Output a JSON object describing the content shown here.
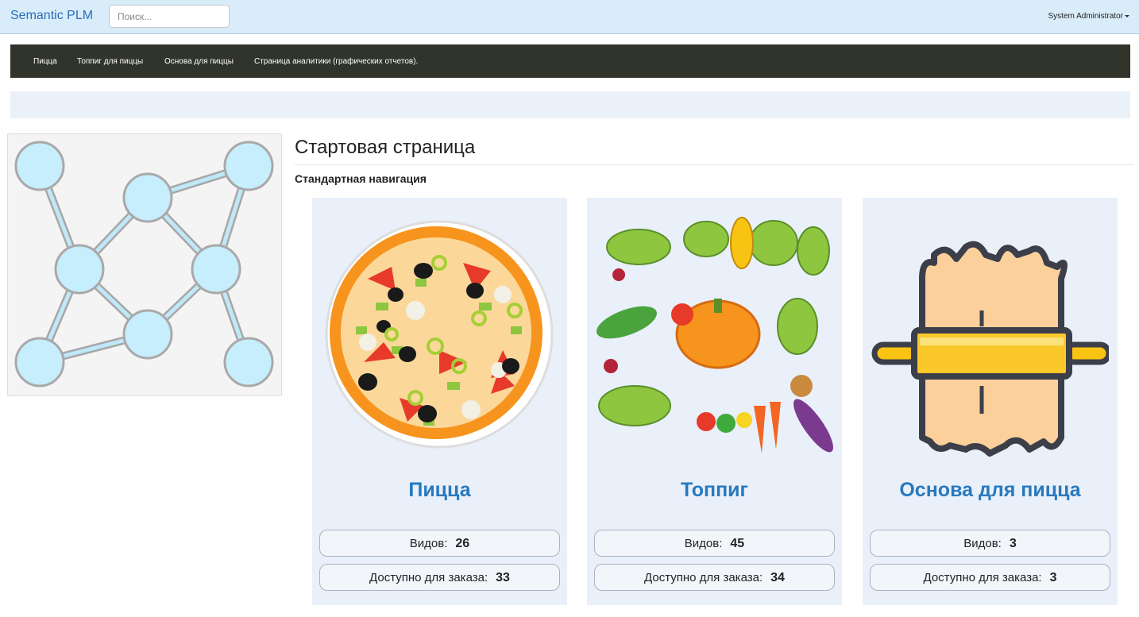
{
  "app": {
    "brand": "Semantic PLM"
  },
  "search": {
    "placeholder": "Поиск..."
  },
  "user": {
    "name": "System Administrator"
  },
  "menu": {
    "items": [
      {
        "label": "Пицца"
      },
      {
        "label": "Топпиг для пиццы"
      },
      {
        "label": "Основа для пиццы"
      },
      {
        "label": "Страница аналитики (графических отчетов)."
      }
    ]
  },
  "main": {
    "title": "Стартовая страница",
    "subtitle": "Стандартная навигация"
  },
  "cards": [
    {
      "title": "Пицца",
      "icon": "pizza-icon",
      "stats": [
        {
          "label": "Видов:",
          "value": "26"
        },
        {
          "label": "Доступно для заказа:",
          "value": "33"
        }
      ]
    },
    {
      "title": "Топпиг",
      "icon": "vegetables-icon",
      "stats": [
        {
          "label": "Видов:",
          "value": "45"
        },
        {
          "label": "Доступно для заказа:",
          "value": "34"
        }
      ]
    },
    {
      "title": "Основа для пицца",
      "icon": "dough-rolling-pin-icon",
      "stats": [
        {
          "label": "Видов:",
          "value": "3"
        },
        {
          "label": "Доступно для заказа:",
          "value": "3"
        }
      ]
    }
  ],
  "colors": {
    "brand": "#2a6ebb",
    "menu_bg": "#30342b",
    "card_bg": "#e9f0f9",
    "card_title": "#2879be"
  }
}
